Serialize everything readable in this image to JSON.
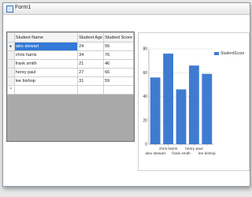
{
  "window": {
    "title": "Form1"
  },
  "grid": {
    "columns": [
      "Student Name",
      "Student Age",
      "Student Score"
    ],
    "rows": [
      {
        "name": "alex stewart",
        "age": "24",
        "score": "56"
      },
      {
        "name": "chris harris",
        "age": "34",
        "score": "76"
      },
      {
        "name": "frank smith",
        "age": "21",
        "score": "46"
      },
      {
        "name": "henry paul",
        "age": "27",
        "score": "66"
      },
      {
        "name": "lee bishop",
        "age": "31",
        "score": "59"
      }
    ],
    "selected_row": 0,
    "new_row_marker": "*",
    "current_row_marker": "▸"
  },
  "colors": {
    "bar": "#3f7bd1",
    "selection": "#3379d7"
  },
  "chart_data": {
    "type": "bar",
    "categories": [
      "alex stewart",
      "chris harris",
      "frank smith",
      "henry paul",
      "lee bishop"
    ],
    "series": [
      {
        "name": "StudentScore",
        "values": [
          56,
          76,
          46,
          66,
          59
        ]
      }
    ],
    "ylim": [
      0,
      80
    ],
    "yticks": [
      "0",
      "20",
      "40",
      "60",
      "80"
    ],
    "legend": "top-right",
    "grid": true
  }
}
